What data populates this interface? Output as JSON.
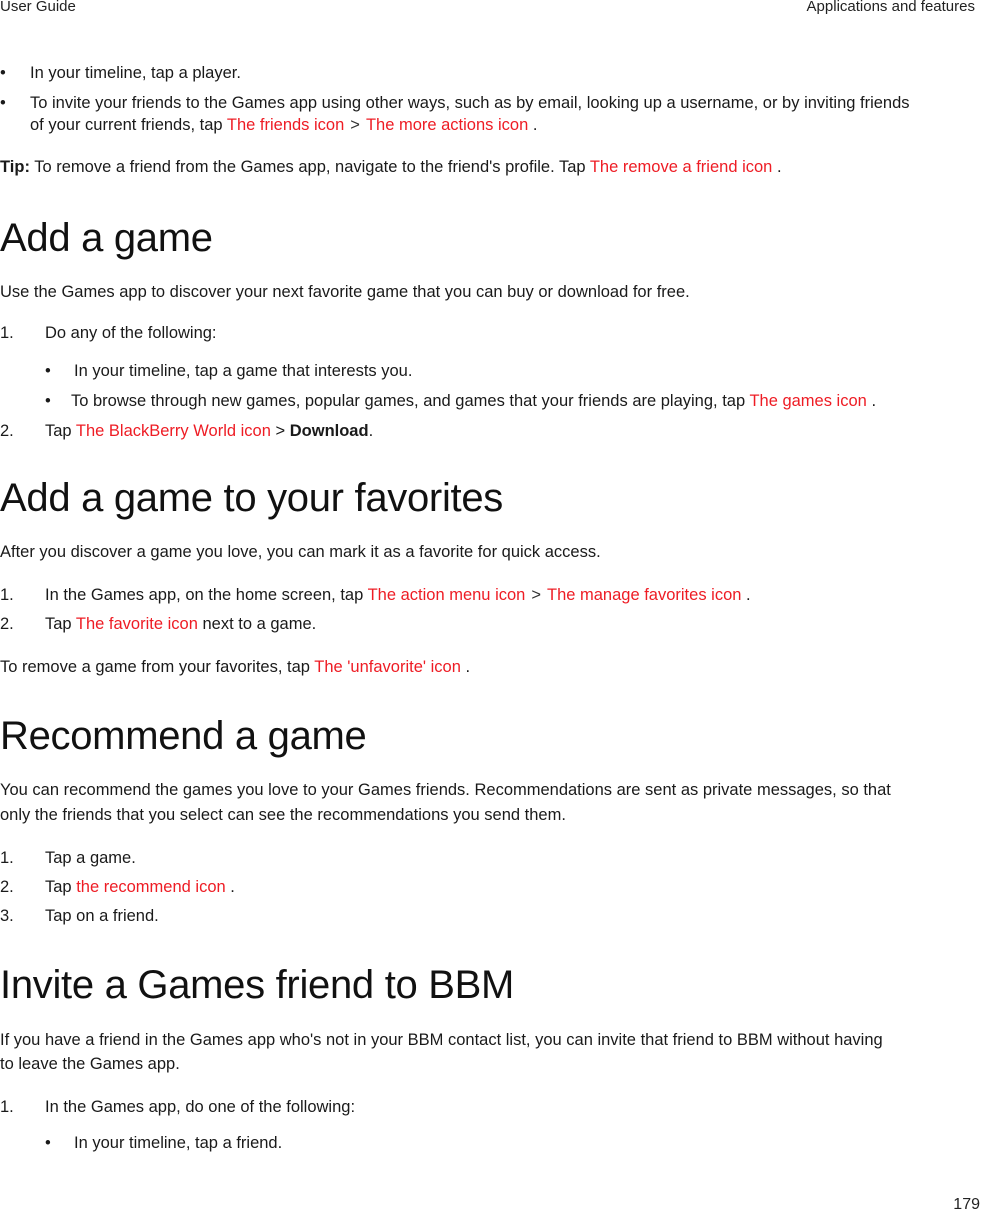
{
  "header": {
    "left": "User Guide",
    "right": "Applications and features"
  },
  "page_number": "179",
  "colors": {
    "link_red": "#ee1c24",
    "text": "#1a1a1a"
  },
  "intro": {
    "bullet1": "In your timeline, tap a player.",
    "bullet2_line1": "To invite your friends to the Games app using other ways, such as by email, looking up a username, or by inviting friends",
    "bullet2_line2_pre": "of your current friends, tap ",
    "friends_icon": "The friends icon",
    "sep": ">",
    "more_actions_icon": "The more actions icon",
    "period": ".",
    "tip_label": "Tip:",
    "tip_text": " To remove a friend from the Games app, navigate to the friend's profile. Tap ",
    "remove_friend_icon": "The remove a friend icon"
  },
  "add_game": {
    "title": "Add a game",
    "desc": "Use the Games app to discover your next favorite game that you can buy or download for free.",
    "step1_num": "1.",
    "step1": "Do any of the following:",
    "sub1": "In your timeline, tap a game that interests you.",
    "sub2_pre": "To browse through new games, popular games, and games that your friends are playing, tap ",
    "games_icon": "The games icon",
    "step2_num": "2.",
    "step2_pre": "Tap ",
    "bbworld_icon": "The BlackBerry World icon",
    "step2_sep": " > ",
    "download": "Download"
  },
  "favorites": {
    "title": "Add a game to your favorites",
    "desc": "After you discover a game you love, you can mark it as a favorite for quick access.",
    "step1_num": "1.",
    "step1_pre": "In the Games app, on the home screen, tap ",
    "action_menu_icon": "The action menu icon",
    "manage_fav_icon": "The manage favorites icon",
    "step2_num": "2.",
    "step2_pre": "Tap ",
    "favorite_icon": "The favorite icon",
    "step2_post": " next to a game.",
    "remove_pre": "To remove a game from your favorites, tap ",
    "unfavorite_icon": "The 'unfavorite' icon"
  },
  "recommend": {
    "title": "Recommend a game",
    "desc1": "You can recommend the games you love to your Games friends. Recommendations are sent as private messages, so that",
    "desc2": "only the friends that you select can see the recommendations you send them.",
    "step1_num": "1.",
    "step1": "Tap a game.",
    "step2_num": "2.",
    "step2_pre": "Tap ",
    "recommend_icon": "the recommend icon",
    "step3_num": "3.",
    "step3": "Tap on a friend."
  },
  "invite": {
    "title": "Invite a Games friend to BBM",
    "desc1": "If you have a friend in the Games app who's not in your BBM contact list, you can invite that friend to BBM without having",
    "desc2": "to leave the Games app.",
    "step1_num": "1.",
    "step1": "In the Games app, do one of the following:",
    "sub1": "In your timeline, tap a friend."
  },
  "bullet_glyph": "•"
}
